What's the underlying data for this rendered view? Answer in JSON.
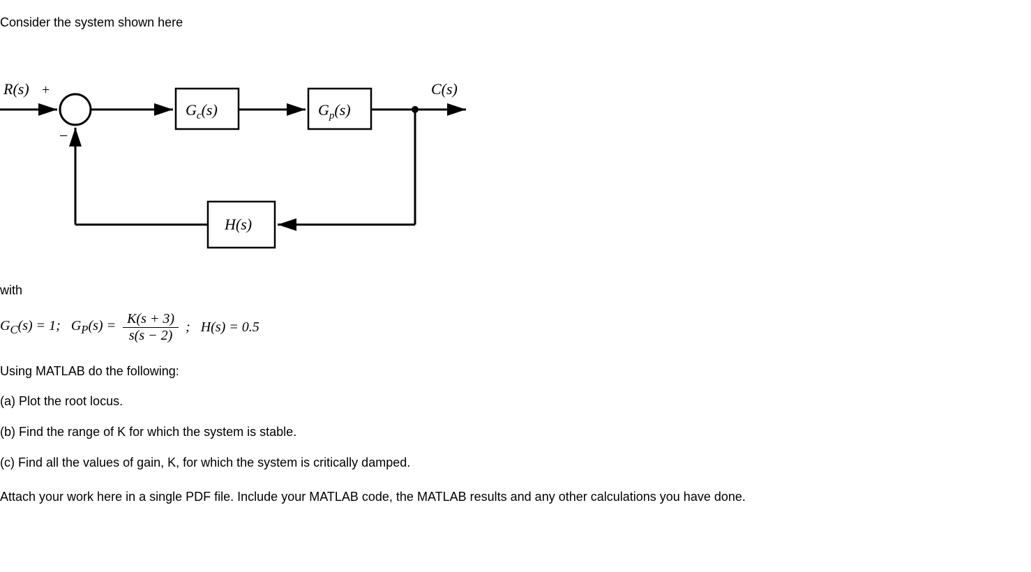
{
  "intro": "Consider the system shown here",
  "diagram": {
    "r_label": "R(s)",
    "plus": "+",
    "minus": "−",
    "gc_label": "G",
    "gc_sub": "c",
    "gc_arg": "(s)",
    "gp_label": "G",
    "gp_sub": "p",
    "gp_arg": "(s)",
    "h_label": "H(s)",
    "c_label": "C(s)"
  },
  "with_text": "with",
  "math": {
    "gc": "G",
    "gc_sub": "C",
    "gc_arg": "(s) = 1;",
    "gp": "G",
    "gp_sub": "P",
    "gp_arg": "(s) =",
    "frac_num": "K(s + 3)",
    "frac_den": "s(s − 2)",
    "semicolon": ";",
    "h": "H(s) = 0.5"
  },
  "instruction": "Using MATLAB do the following:",
  "part_a": "(a) Plot the root locus.",
  "part_b": "(b) Find the range of K for which the system is stable.",
  "part_c": "(c) Find all the values of gain, K, for which the system is critically damped.",
  "footer": "Attach your work here in a single PDF file. Include your MATLAB code, the MATLAB results and any other calculations you have done."
}
